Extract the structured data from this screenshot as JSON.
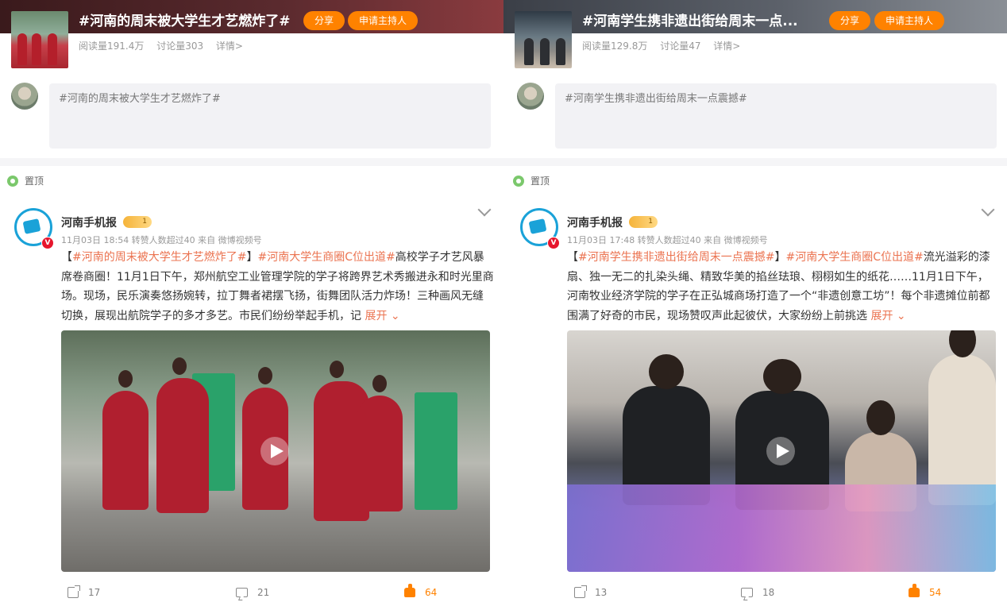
{
  "columns": [
    {
      "topic": {
        "title": "#河南的周末被大学生才艺燃炸了#",
        "share_label": "分享",
        "host_label": "申请主持人",
        "reads": "阅读量191.4万",
        "discussions": "讨论量303",
        "detail": "详情>"
      },
      "compose_text": "#河南的周末被大学生才艺燃炸了#",
      "pinned_label": "置顶",
      "post": {
        "author": "河南手机报",
        "meta": "11月03日 18:54 转赞人数超过40  来自 微博视频号",
        "text_parts": [
          {
            "t": "【",
            "tag": false
          },
          {
            "t": "#河南的周末被大学生才艺燃炸了#",
            "tag": true
          },
          {
            "t": "】",
            "tag": false
          },
          {
            "t": "#河南大学生商圈C位出道#",
            "tag": true
          },
          {
            "t": "高校学子才艺风暴席卷商圈！11月1日下午，郑州航空工业管理学院的学子将跨界艺术秀搬进永和时光里商场。现场，民乐演奏悠扬婉转，拉丁舞者裙摆飞扬，街舞团队活力炸场！三种画风无缝切换，展现出航院学子的多才多艺。市民们纷纷举起手机，记 ",
            "tag": false
          }
        ],
        "expand": "展开",
        "reposts": "17",
        "comments": "21",
        "likes": "64"
      }
    },
    {
      "topic": {
        "title": "#河南学生携非遗出街给周末一点...",
        "share_label": "分享",
        "host_label": "申请主持人",
        "reads": "阅读量129.8万",
        "discussions": "讨论量47",
        "detail": "详情>"
      },
      "compose_text": "#河南学生携非遗出街给周末一点震撼#",
      "pinned_label": "置顶",
      "post": {
        "author": "河南手机报",
        "meta": "11月03日 17:48 转赞人数超过40  来自 微博视频号",
        "text_parts": [
          {
            "t": "【",
            "tag": false
          },
          {
            "t": "#河南学生携非遗出街给周末一点震撼#",
            "tag": true
          },
          {
            "t": "】",
            "tag": false
          },
          {
            "t": "#河南大学生商圈C位出道#",
            "tag": true
          },
          {
            "t": "流光溢彩的漆扇、独一无二的扎染头绳、精致华美的掐丝珐琅、栩栩如生的纸花……11月1日下午，河南牧业经济学院的学子在正弘城商场打造了一个“非遗创意工坊”！每个非遗摊位前都围满了好奇的市民，现场赞叹声此起彼伏，大家纷纷上前挑选 ",
            "tag": false
          }
        ],
        "expand": "展开",
        "reposts": "13",
        "comments": "18",
        "likes": "54"
      }
    }
  ],
  "colors": {
    "accent": "#ff8200",
    "hashtag": "#eb7350",
    "muted": "#999999"
  }
}
